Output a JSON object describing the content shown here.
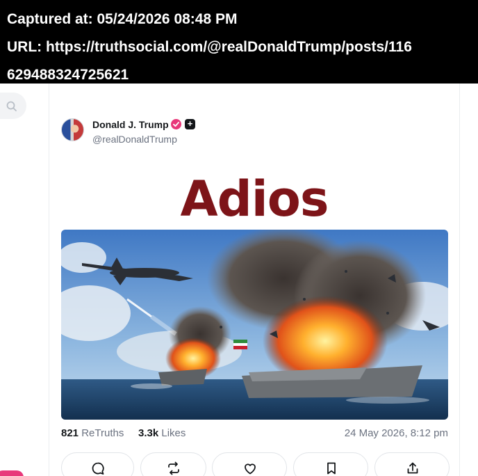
{
  "capture": {
    "captured_line": "Captured at: 05/24/2026 08:48 PM",
    "url_line_1": "URL: https://truthsocial.com/@realDonaldTrump/posts/116",
    "url_line_2": "629488324725621"
  },
  "post": {
    "author": {
      "display_name": "Donald J. Trump",
      "handle": "@realDonaldTrump"
    },
    "title_text": "Adios",
    "stats": {
      "retruths_count": "821",
      "retruths_label": "ReTruths",
      "likes_count": "3.3k",
      "likes_label": "Likes"
    },
    "timestamp": "24 May 2026, 8:12 pm"
  },
  "colors": {
    "accent_pink": "#e8387a",
    "title_red": "#7d1418"
  },
  "icons": {
    "search": "search-icon",
    "verified": "verified-badge-icon",
    "plus": "plus-badge-icon",
    "reply": "reply-icon",
    "retruth": "retruth-icon",
    "like": "heart-icon",
    "bookmark": "bookmark-icon",
    "share": "share-icon"
  }
}
